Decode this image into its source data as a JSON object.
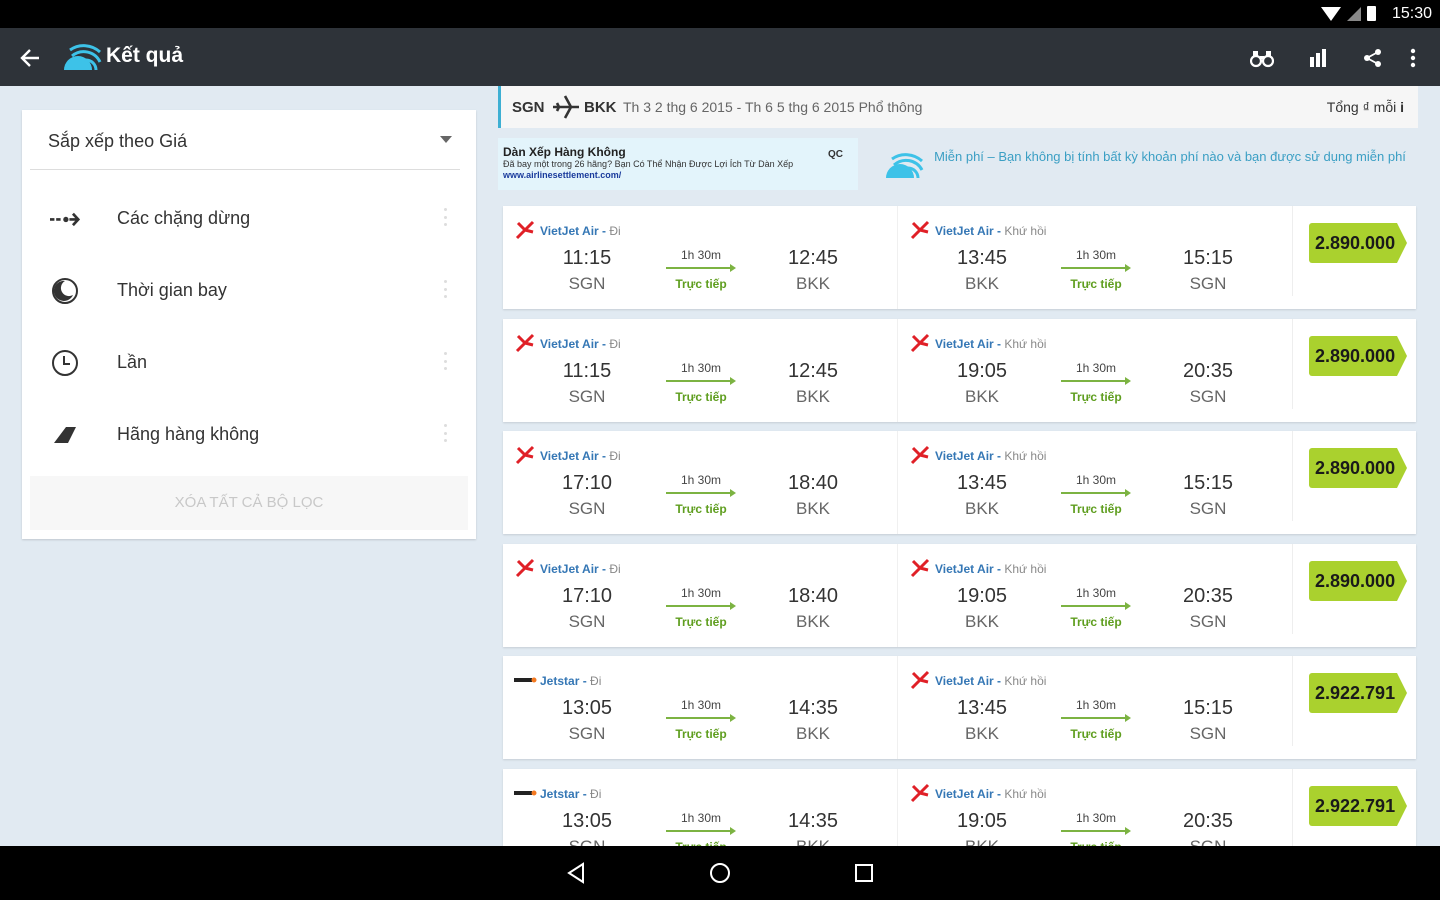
{
  "status_bar": {
    "time": "15:30"
  },
  "toolbar": {
    "title": "Kết quả"
  },
  "filter_panel": {
    "sort_label": "Sắp xếp theo Giá",
    "items": [
      {
        "label": "Các chặng dừng",
        "icon": "stops-icon"
      },
      {
        "label": "Thời gian bay",
        "icon": "flight-time-icon"
      },
      {
        "label": "Lần",
        "icon": "clock-icon"
      },
      {
        "label": "Hãng hàng không",
        "icon": "airline-tail-icon"
      }
    ],
    "clear_label": "XÓA TẤT CẢ BỘ LỌC"
  },
  "summary": {
    "from": "SGN",
    "to": "BKK",
    "dates": "Th 3 2 thg 6 2015 - Th 6 5 thg 6 2015  Phổ thông",
    "total": "Tổng ₫ mỗi"
  },
  "ad": {
    "title": "Dàn Xếp Hàng Không",
    "text": "Đã bay một trong 26 hãng? Bạn Có Thể Nhận Được Lợi Ích Từ Dàn Xếp",
    "url": "www.airlinesettlement.com/",
    "tag": "QC"
  },
  "free_notice": "Miễn phí – Bạn không bị tính bất kỳ khoản phí nào và bạn được sử dụng miễn phí",
  "results": [
    {
      "outbound": {
        "airline": "VietJet Air",
        "dir": "Đi",
        "dep_time": "11:15",
        "dep_code": "SGN",
        "arr_time": "12:45",
        "arr_code": "BKK",
        "duration": "1h 30m",
        "stops": "Trực tiếp"
      },
      "inbound": {
        "airline": "VietJet Air",
        "dir": "Khứ hồi",
        "dep_time": "13:45",
        "dep_code": "BKK",
        "arr_time": "15:15",
        "arr_code": "SGN",
        "duration": "1h 30m",
        "stops": "Trực tiếp"
      },
      "price": "2.890.000"
    },
    {
      "outbound": {
        "airline": "VietJet Air",
        "dir": "Đi",
        "dep_time": "11:15",
        "dep_code": "SGN",
        "arr_time": "12:45",
        "arr_code": "BKK",
        "duration": "1h 30m",
        "stops": "Trực tiếp"
      },
      "inbound": {
        "airline": "VietJet Air",
        "dir": "Khứ hồi",
        "dep_time": "19:05",
        "dep_code": "BKK",
        "arr_time": "20:35",
        "arr_code": "SGN",
        "duration": "1h 30m",
        "stops": "Trực tiếp"
      },
      "price": "2.890.000"
    },
    {
      "outbound": {
        "airline": "VietJet Air",
        "dir": "Đi",
        "dep_time": "17:10",
        "dep_code": "SGN",
        "arr_time": "18:40",
        "arr_code": "BKK",
        "duration": "1h 30m",
        "stops": "Trực tiếp"
      },
      "inbound": {
        "airline": "VietJet Air",
        "dir": "Khứ hồi",
        "dep_time": "13:45",
        "dep_code": "BKK",
        "arr_time": "15:15",
        "arr_code": "SGN",
        "duration": "1h 30m",
        "stops": "Trực tiếp"
      },
      "price": "2.890.000"
    },
    {
      "outbound": {
        "airline": "VietJet Air",
        "dir": "Đi",
        "dep_time": "17:10",
        "dep_code": "SGN",
        "arr_time": "18:40",
        "arr_code": "BKK",
        "duration": "1h 30m",
        "stops": "Trực tiếp"
      },
      "inbound": {
        "airline": "VietJet Air",
        "dir": "Khứ hồi",
        "dep_time": "19:05",
        "dep_code": "BKK",
        "arr_time": "20:35",
        "arr_code": "SGN",
        "duration": "1h 30m",
        "stops": "Trực tiếp"
      },
      "price": "2.890.000"
    },
    {
      "outbound": {
        "airline": "Jetstar",
        "dir": "Đi",
        "dep_time": "13:05",
        "dep_code": "SGN",
        "arr_time": "14:35",
        "arr_code": "BKK",
        "duration": "1h 30m",
        "stops": "Trực tiếp"
      },
      "inbound": {
        "airline": "VietJet Air",
        "dir": "Khứ hồi",
        "dep_time": "13:45",
        "dep_code": "BKK",
        "arr_time": "15:15",
        "arr_code": "SGN",
        "duration": "1h 30m",
        "stops": "Trực tiếp"
      },
      "price": "2.922.791"
    },
    {
      "outbound": {
        "airline": "Jetstar",
        "dir": "Đi",
        "dep_time": "13:05",
        "dep_code": "SGN",
        "arr_time": "14:35",
        "arr_code": "BKK",
        "duration": "1h 30m",
        "stops": "Trực tiếp"
      },
      "inbound": {
        "airline": "VietJet Air",
        "dir": "Khứ hồi",
        "dep_time": "19:05",
        "dep_code": "BKK",
        "arr_time": "20:35",
        "arr_code": "SGN",
        "duration": "1h 30m",
        "stops": "Trực tiếp"
      },
      "price": "2.922.791"
    }
  ],
  "colors": {
    "toolbar": "#2e3339",
    "accent": "#3dafd3",
    "price": "#aad12e",
    "direct": "#5f9e1f",
    "airline_name": "#3577b5"
  }
}
